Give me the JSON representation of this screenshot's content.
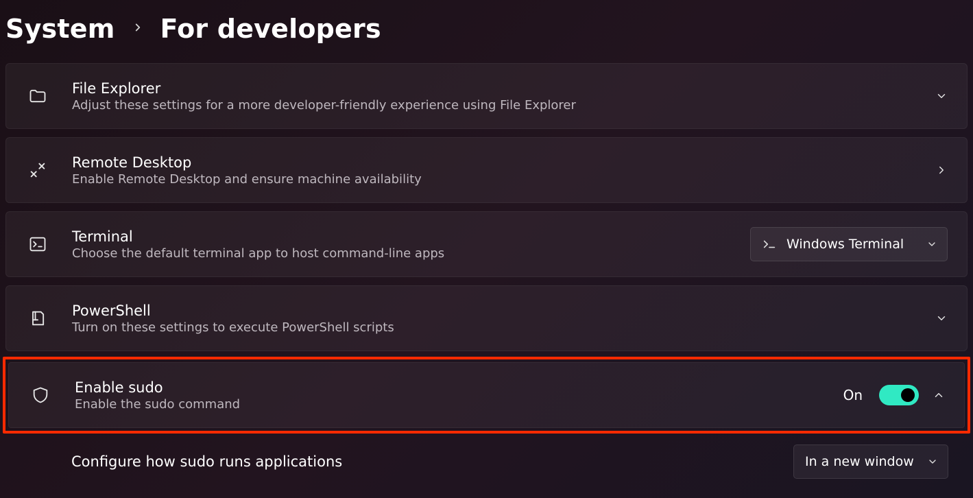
{
  "breadcrumb": {
    "parent": "System",
    "current": "For developers"
  },
  "items": {
    "file_explorer": {
      "title": "File Explorer",
      "desc": "Adjust these settings for a more developer-friendly experience using File Explorer"
    },
    "remote_desktop": {
      "title": "Remote Desktop",
      "desc": "Enable Remote Desktop and ensure machine availability"
    },
    "terminal": {
      "title": "Terminal",
      "desc": "Choose the default terminal app to host command-line apps",
      "dropdown_value": "Windows Terminal"
    },
    "powershell": {
      "title": "PowerShell",
      "desc": "Turn on these settings to execute PowerShell scripts"
    },
    "enable_sudo": {
      "title": "Enable sudo",
      "desc": "Enable the sudo command",
      "toggle_state_label": "On"
    },
    "sudo_config": {
      "title": "Configure how sudo runs applications",
      "dropdown_value": "In a new window"
    }
  }
}
